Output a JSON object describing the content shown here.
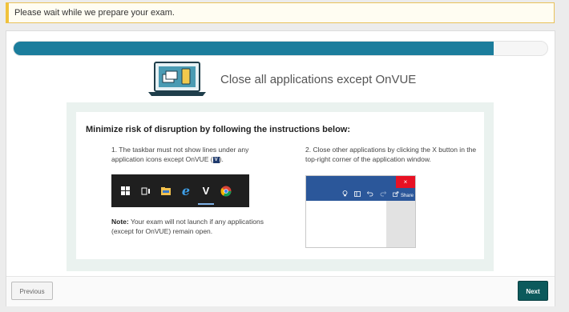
{
  "alert": {
    "text": "Please wait while we prepare your exam."
  },
  "progress": {
    "fraction": 0.9
  },
  "header": {
    "title": "Close all applications except OnVUE"
  },
  "instructions": {
    "heading": "Minimize risk of disruption by following the instructions below:",
    "step1_text_a": "1. The taskbar must not show lines under any application icons except OnVUE (",
    "step1_badge": "V",
    "step1_text_b": ").",
    "step2_text": "2. Close other applications by clicking the X button in the top-right corner of the application window.",
    "note_label": "Note:",
    "note_text": " Your exam will not launch if any applications (except for OnVUE) remain open.",
    "taskbar_icons": [
      "windows-icon",
      "task-view-icon",
      "file-explorer-icon",
      "edge-icon",
      "onvue-icon",
      "chrome-icon"
    ],
    "onvue_letter": "V",
    "edge_letter": "e",
    "app_window": {
      "close_glyph": "×",
      "share_label": "Share"
    }
  },
  "footer": {
    "prev_label": "Previous",
    "next_label": "Next"
  },
  "colors": {
    "accent": "#1b7d9c",
    "next_button": "#0c5a5c",
    "close_red": "#e81123",
    "app_bar": "#2b579a"
  }
}
